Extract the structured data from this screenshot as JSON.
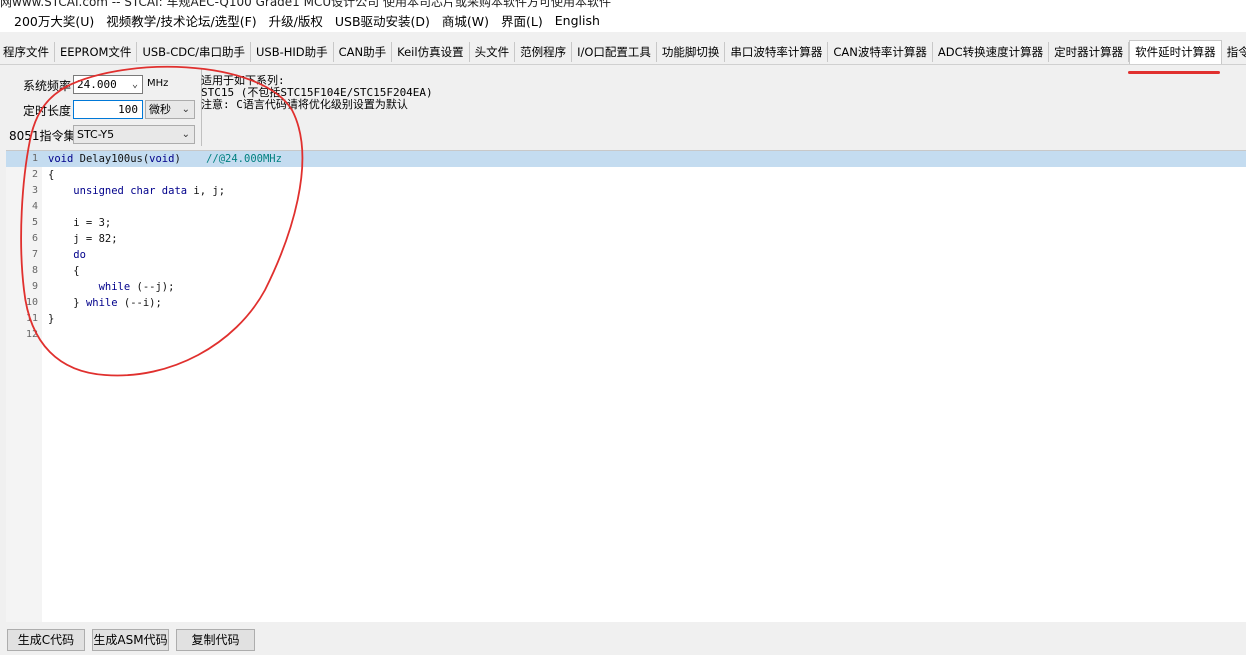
{
  "window": {
    "title": "网www.STCAI.com -- STCAI: 车规AEC-Q100 Grade1 MCU设计公司 使用本司芯片或采购本软件方可使用本软件"
  },
  "menu": [
    "200万大奖(U)",
    "视频教学/技术论坛/选型(F)",
    "升级/版权",
    "USB驱动安装(D)",
    "商城(W)",
    "界面(L)",
    "English"
  ],
  "tabs": [
    "程序文件",
    "EEPROM文件",
    "USB-CDC/串口助手",
    "USB-HID助手",
    "CAN助手",
    "Keil仿真设置",
    "头文件",
    "范例程序",
    "I/O口配置工具",
    "功能脚切换",
    "串口波特率计算器",
    "CAN波特率计算器",
    "ADC转换速度计算器",
    "定时器计算器",
    "软件延时计算器",
    "指令"
  ],
  "active_tab_index": 14,
  "settings": {
    "freq_label": "系统频率",
    "freq_value": "24.000",
    "freq_unit": "MHz",
    "duration_label": "定时长度",
    "duration_value": "100",
    "duration_unit": "微秒",
    "isa_label": "8051指令集",
    "isa_value": "STC-Y5"
  },
  "info": {
    "line1": "适用于如下系列:",
    "line2": "STC15 (不包括STC15F104E/STC15F204EA)",
    "line3": "注意: C语言代码请将优化级别设置为默认"
  },
  "code_lines": [
    {
      "n": "1",
      "parts": [
        {
          "t": "void",
          "c": "kw"
        },
        {
          "t": " Delay100us("
        },
        {
          "t": "void",
          "c": "kw"
        },
        {
          "t": ")    "
        },
        {
          "t": "//@24.000MHz",
          "c": "cm"
        }
      ]
    },
    {
      "n": "2",
      "parts": [
        {
          "t": "{"
        }
      ]
    },
    {
      "n": "3",
      "parts": [
        {
          "t": "    "
        },
        {
          "t": "unsigned char data",
          "c": "kw"
        },
        {
          "t": " i, j;"
        }
      ]
    },
    {
      "n": "4",
      "parts": []
    },
    {
      "n": "5",
      "parts": [
        {
          "t": "    i = 3;"
        }
      ]
    },
    {
      "n": "6",
      "parts": [
        {
          "t": "    j = 82;"
        }
      ]
    },
    {
      "n": "7",
      "parts": [
        {
          "t": "    "
        },
        {
          "t": "do",
          "c": "kw"
        }
      ]
    },
    {
      "n": "8",
      "parts": [
        {
          "t": "    {"
        }
      ]
    },
    {
      "n": "9",
      "parts": [
        {
          "t": "        "
        },
        {
          "t": "while",
          "c": "kw"
        },
        {
          "t": " (--j);"
        }
      ]
    },
    {
      "n": "10",
      "parts": [
        {
          "t": "    } "
        },
        {
          "t": "while",
          "c": "kw"
        },
        {
          "t": " (--i);"
        }
      ]
    },
    {
      "n": "11",
      "parts": [
        {
          "t": "}"
        }
      ]
    },
    {
      "n": "12",
      "parts": []
    }
  ],
  "buttons": {
    "gen_c": "生成C代码",
    "gen_asm": "生成ASM代码",
    "copy": "复制代码"
  },
  "colors": {
    "annotation": "#e0302e",
    "highlight": "#c4dcf0",
    "keyword": "#00008b",
    "comment": "#008080"
  }
}
